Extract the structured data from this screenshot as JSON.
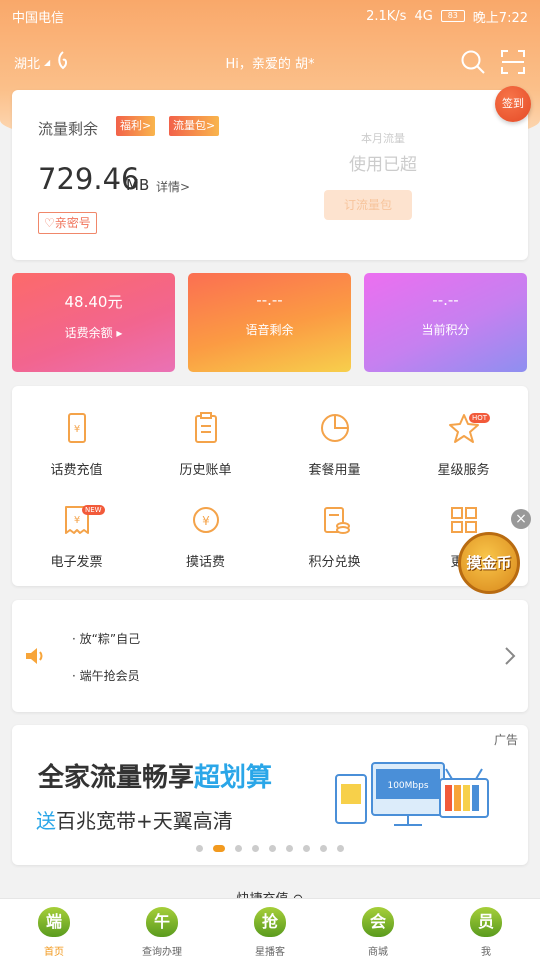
{
  "status_bar": {
    "carrier": "中国电信",
    "speed": "2.1K/s",
    "network": "4G",
    "battery": "83",
    "time": "晚上7:22"
  },
  "header": {
    "region": "湖北",
    "greeting": "Hi，亲爱的 胡*"
  },
  "flow": {
    "title": "流量剩余",
    "tag1": "福利>",
    "tag2": "流量包>",
    "amount": "729.46",
    "unit": "MB",
    "detail": "详情>",
    "secret": "亲密号",
    "month_label": "本月流量",
    "used_label": "使用已超",
    "order_button": "订流量包",
    "signin": "签到"
  },
  "stats": [
    {
      "value": "48.40元",
      "label": "话费余额 ▸"
    },
    {
      "value": "--.--",
      "label": "语音剩余"
    },
    {
      "value": "--.--",
      "label": "当前积分"
    }
  ],
  "services": [
    {
      "label": "话费充值",
      "icon": "phone-recharge-icon"
    },
    {
      "label": "历史账单",
      "icon": "bill-icon"
    },
    {
      "label": "套餐用量",
      "icon": "pie-icon"
    },
    {
      "label": "星级服务",
      "icon": "star-icon",
      "badge": "HOT"
    },
    {
      "label": "电子发票",
      "icon": "invoice-icon",
      "badge": "NEW"
    },
    {
      "label": "摸话费",
      "icon": "coin-icon"
    },
    {
      "label": "积分兑换",
      "icon": "points-icon"
    },
    {
      "label": "更多",
      "icon": "grid-icon"
    }
  ],
  "coin_widget": "摸金币",
  "notices": [
    "放“粽”自己",
    "端午抢会员"
  ],
  "ad": {
    "tag": "广告",
    "headline_a": "全家流量畅享",
    "headline_b": "超划算",
    "sub_a": "送",
    "sub_b": "百兆宽带+天翼高清",
    "monitor_text": "100Mbps",
    "slide_count": 9,
    "active_slide": 2
  },
  "more_link": "快捷充值",
  "tabs": [
    {
      "icon_char": "端",
      "label": "首页",
      "active": true
    },
    {
      "icon_char": "午",
      "label": "查询办理",
      "active": false
    },
    {
      "icon_char": "抢",
      "label": "星播客",
      "active": false
    },
    {
      "icon_char": "会",
      "label": "商城",
      "active": false
    },
    {
      "icon_char": "员",
      "label": "我",
      "active": false
    }
  ],
  "colors": {
    "accent": "#f29a1f",
    "header_top": "#f9a86a",
    "ad_highlight": "#2aa6e8"
  }
}
